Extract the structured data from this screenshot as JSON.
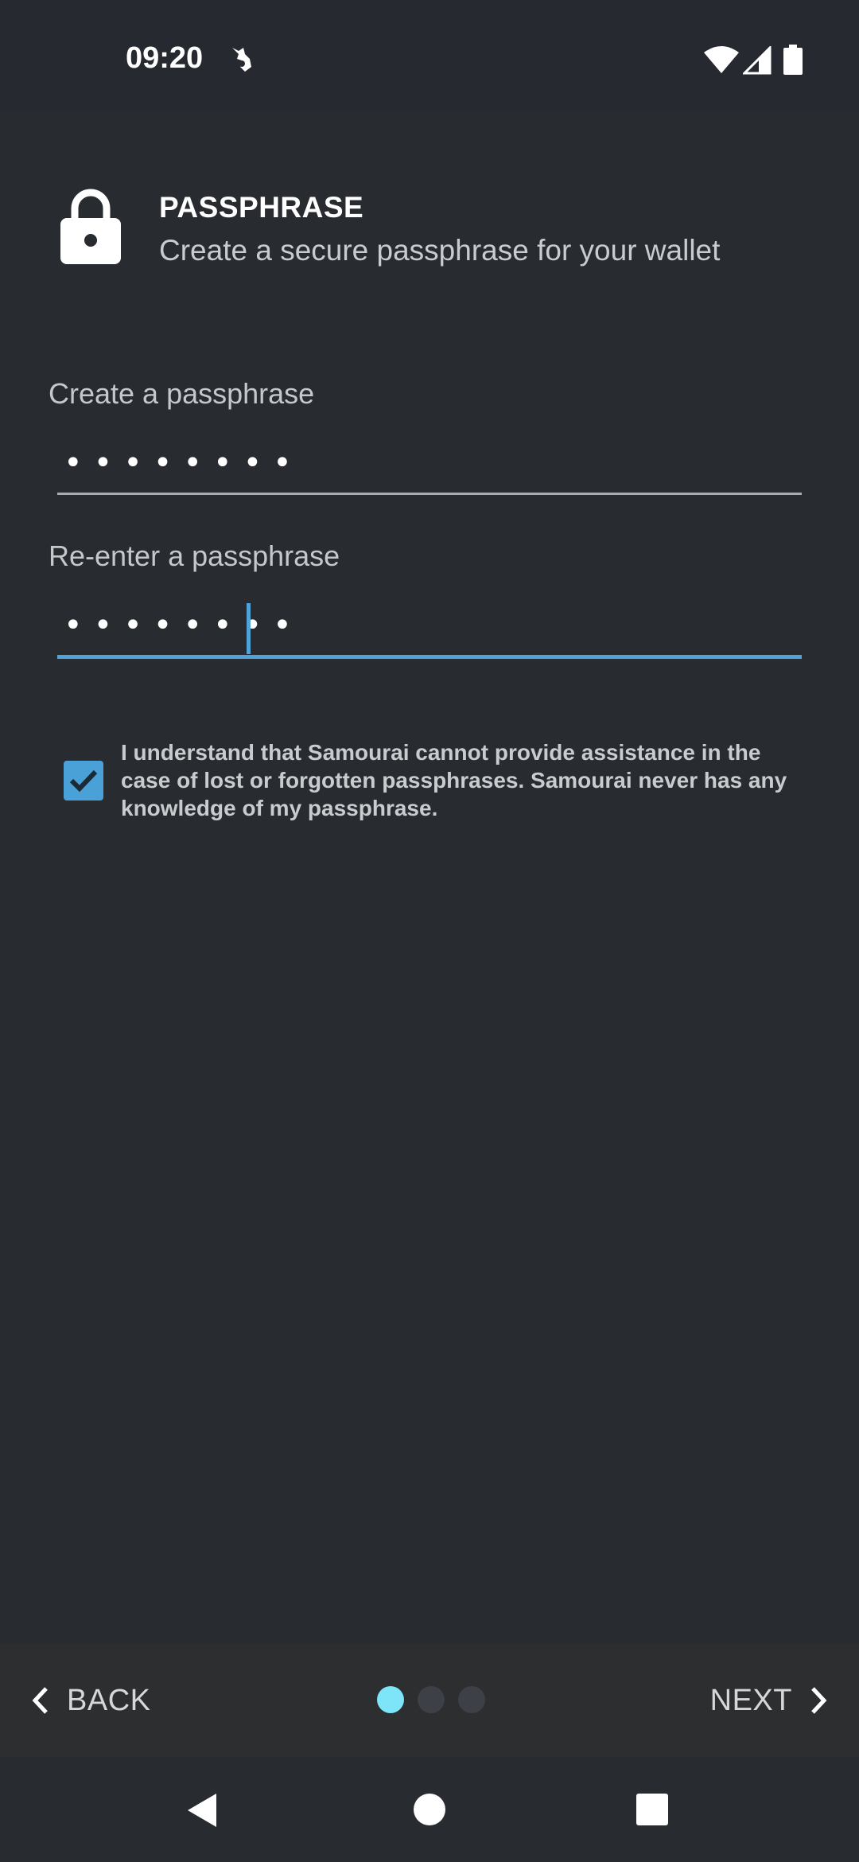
{
  "status_bar": {
    "time": "09:20"
  },
  "header": {
    "title": "PASSPHRASE",
    "subtitle": "Create a secure passphrase for your wallet"
  },
  "form": {
    "create_label": "Create a passphrase",
    "create_value_masked": "••••••••",
    "reenter_label": "Re-enter a passphrase",
    "reenter_value_masked": "••••••••",
    "consent_checked": true,
    "consent_text": "I understand that Samourai cannot provide assistance in the case of lost or forgotten passphrases. Samourai never has any knowledge of my passphrase."
  },
  "bottom_nav": {
    "back_label": "BACK",
    "next_label": "NEXT",
    "step_current": 1,
    "step_total": 3
  },
  "colors": {
    "background": "#282b2f",
    "accent": "#4fa3d9",
    "active_dot": "#7ee4f7",
    "inactive_dot": "#3d4147"
  }
}
